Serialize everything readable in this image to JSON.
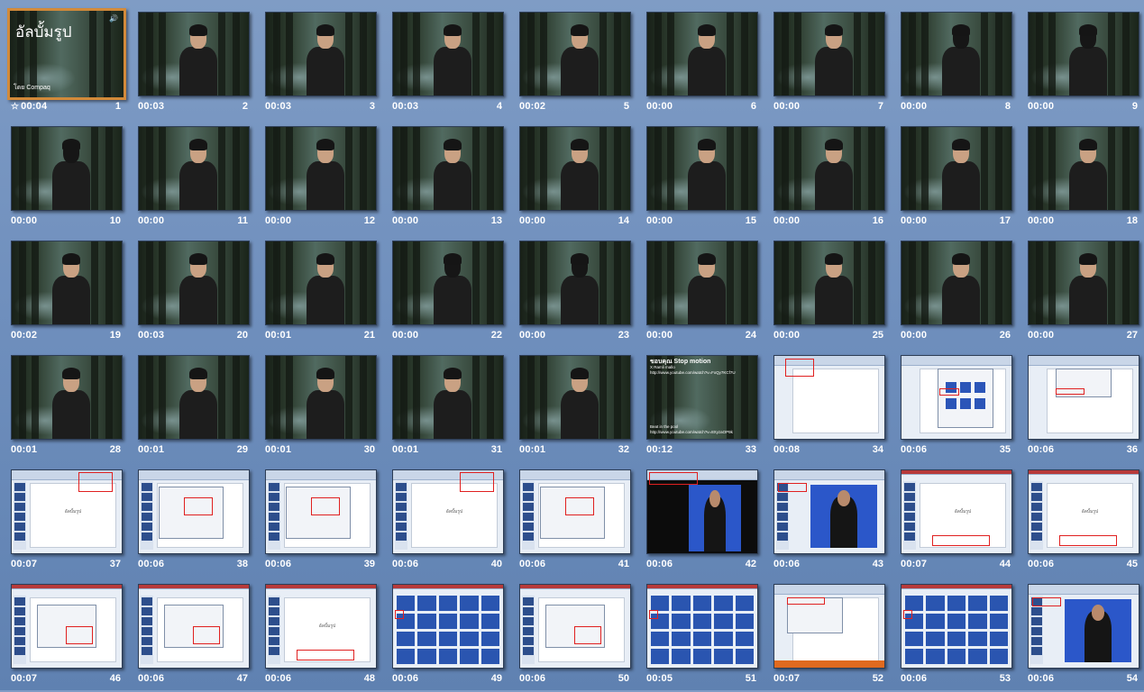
{
  "album_title": "อัลบั้มรูป",
  "album_subtitle": "โดย Compaq",
  "credit_slide": {
    "heading": "ขอบคุณ Stop motion",
    "line1": "X Ramli mallo",
    "url1": "http://www.youtube.com/watch?v=FxQy7KCf7U",
    "line2": "Beat in the pool",
    "url2": "http://www.youtube.com/watch?v=8XyzaOP9k"
  },
  "slides": [
    {
      "n": "1",
      "t": "00:04",
      "kind": "title",
      "selected": true,
      "star": true
    },
    {
      "n": "2",
      "t": "00:03",
      "kind": "forest"
    },
    {
      "n": "3",
      "t": "00:03",
      "kind": "forest"
    },
    {
      "n": "4",
      "t": "00:03",
      "kind": "forest"
    },
    {
      "n": "5",
      "t": "00:02",
      "kind": "forest"
    },
    {
      "n": "6",
      "t": "00:00",
      "kind": "forest"
    },
    {
      "n": "7",
      "t": "00:00",
      "kind": "forest"
    },
    {
      "n": "8",
      "t": "00:00",
      "kind": "forest-back"
    },
    {
      "n": "9",
      "t": "00:00",
      "kind": "forest-back"
    },
    {
      "n": "10",
      "t": "00:00",
      "kind": "forest-back"
    },
    {
      "n": "11",
      "t": "00:00",
      "kind": "forest"
    },
    {
      "n": "12",
      "t": "00:00",
      "kind": "forest"
    },
    {
      "n": "13",
      "t": "00:00",
      "kind": "forest"
    },
    {
      "n": "14",
      "t": "00:00",
      "kind": "forest"
    },
    {
      "n": "15",
      "t": "00:00",
      "kind": "forest"
    },
    {
      "n": "16",
      "t": "00:00",
      "kind": "forest"
    },
    {
      "n": "17",
      "t": "00:00",
      "kind": "forest"
    },
    {
      "n": "18",
      "t": "00:00",
      "kind": "forest"
    },
    {
      "n": "19",
      "t": "00:02",
      "kind": "forest"
    },
    {
      "n": "20",
      "t": "00:03",
      "kind": "forest"
    },
    {
      "n": "21",
      "t": "00:01",
      "kind": "forest"
    },
    {
      "n": "22",
      "t": "00:00",
      "kind": "forest-back"
    },
    {
      "n": "23",
      "t": "00:00",
      "kind": "forest-back"
    },
    {
      "n": "24",
      "t": "00:00",
      "kind": "forest"
    },
    {
      "n": "25",
      "t": "00:00",
      "kind": "forest"
    },
    {
      "n": "26",
      "t": "00:00",
      "kind": "forest"
    },
    {
      "n": "27",
      "t": "00:00",
      "kind": "forest"
    },
    {
      "n": "28",
      "t": "00:01",
      "kind": "forest"
    },
    {
      "n": "29",
      "t": "00:01",
      "kind": "forest"
    },
    {
      "n": "30",
      "t": "00:01",
      "kind": "forest"
    },
    {
      "n": "31",
      "t": "00:01",
      "kind": "forest"
    },
    {
      "n": "32",
      "t": "00:01",
      "kind": "forest"
    },
    {
      "n": "33",
      "t": "00:12",
      "kind": "credit"
    },
    {
      "n": "34",
      "t": "00:08",
      "kind": "office-blank"
    },
    {
      "n": "35",
      "t": "00:06",
      "kind": "office-dialog"
    },
    {
      "n": "36",
      "t": "00:06",
      "kind": "office-dialog2"
    },
    {
      "n": "37",
      "t": "00:07",
      "kind": "office-side"
    },
    {
      "n": "38",
      "t": "00:06",
      "kind": "office-side-dialog"
    },
    {
      "n": "39",
      "t": "00:06",
      "kind": "office-side-dialog"
    },
    {
      "n": "40",
      "t": "00:06",
      "kind": "office-side"
    },
    {
      "n": "41",
      "t": "00:06",
      "kind": "office-side-dialog"
    },
    {
      "n": "42",
      "t": "00:06",
      "kind": "office-dark-photo"
    },
    {
      "n": "43",
      "t": "00:06",
      "kind": "office-photo"
    },
    {
      "n": "44",
      "t": "00:07",
      "kind": "office-red-side"
    },
    {
      "n": "45",
      "t": "00:06",
      "kind": "office-red-side"
    },
    {
      "n": "46",
      "t": "00:07",
      "kind": "office-red-dialog"
    },
    {
      "n": "47",
      "t": "00:06",
      "kind": "office-red-dialog"
    },
    {
      "n": "48",
      "t": "00:06",
      "kind": "office-red-side"
    },
    {
      "n": "49",
      "t": "00:06",
      "kind": "office-grid"
    },
    {
      "n": "50",
      "t": "00:06",
      "kind": "office-red-dialog"
    },
    {
      "n": "51",
      "t": "00:05",
      "kind": "office-grid"
    },
    {
      "n": "52",
      "t": "00:07",
      "kind": "office-orange"
    },
    {
      "n": "53",
      "t": "00:06",
      "kind": "office-grid"
    },
    {
      "n": "54",
      "t": "00:06",
      "kind": "office-photo"
    }
  ]
}
